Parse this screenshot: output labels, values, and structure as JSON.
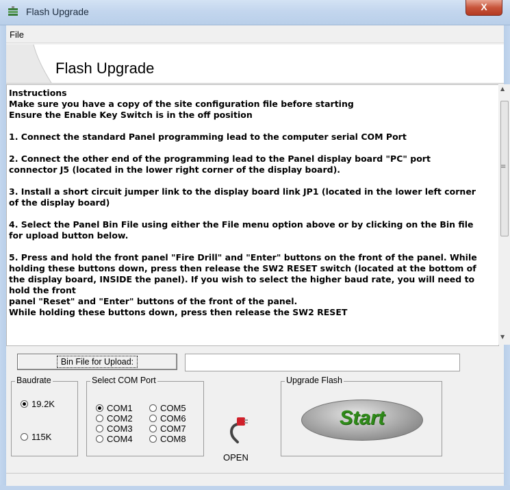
{
  "window": {
    "title": "Flash Upgrade",
    "close_label": "X"
  },
  "menu": {
    "file_label": "File"
  },
  "banner": {
    "title": "Flash Upgrade"
  },
  "instructions": {
    "text": "Instructions\nMake sure you have a copy of the site configuration file before starting\nEnsure the Enable Key Switch is in the off position\n\n1. Connect the standard Panel programming lead to the computer serial COM Port\n\n2. Connect the other end of the programming lead to the Panel display board \"PC\" port\nconnector J5 (located in the lower right corner of the display board).\n\n3. Install a short circuit jumper link to the display board link JP1 (located in the lower left corner\nof the display board)\n\n4. Select the Panel Bin File using either the File menu option above or by clicking on the Bin file\nfor upload button below.\n\n5. Press and hold the front panel \"Fire Drill\" and \"Enter\" buttons on the front of the panel. While\nholding these buttons down, press then release the SW2 RESET switch (located at the bottom of\nthe display board, INSIDE the panel). If you wish to select the higher baud rate, you will need to\nhold the front\npanel \"Reset\" and \"Enter\" buttons of the front of the panel.\nWhile holding these buttons down, press then release the SW2 RESET"
  },
  "upload": {
    "button_label": "Bin File for Upload:",
    "path_value": ""
  },
  "baudrate": {
    "label": "Baudrate",
    "options": [
      "19.2K",
      "115K"
    ],
    "selected": "19.2K"
  },
  "com_port": {
    "label": "Select COM Port",
    "options": [
      "COM1",
      "COM2",
      "COM3",
      "COM4",
      "COM5",
      "COM6",
      "COM7",
      "COM8"
    ],
    "selected": "COM1",
    "open_label": "OPEN"
  },
  "upgrade": {
    "label": "Upgrade Flash",
    "start_label": "Start"
  },
  "colors": {
    "start_text": "#2f8a19",
    "close_button": "#c8553b",
    "plug_red": "#d0202a"
  },
  "icons": {
    "title": "flash-upgrade-app-icon",
    "plug": "serial-plug-icon"
  }
}
